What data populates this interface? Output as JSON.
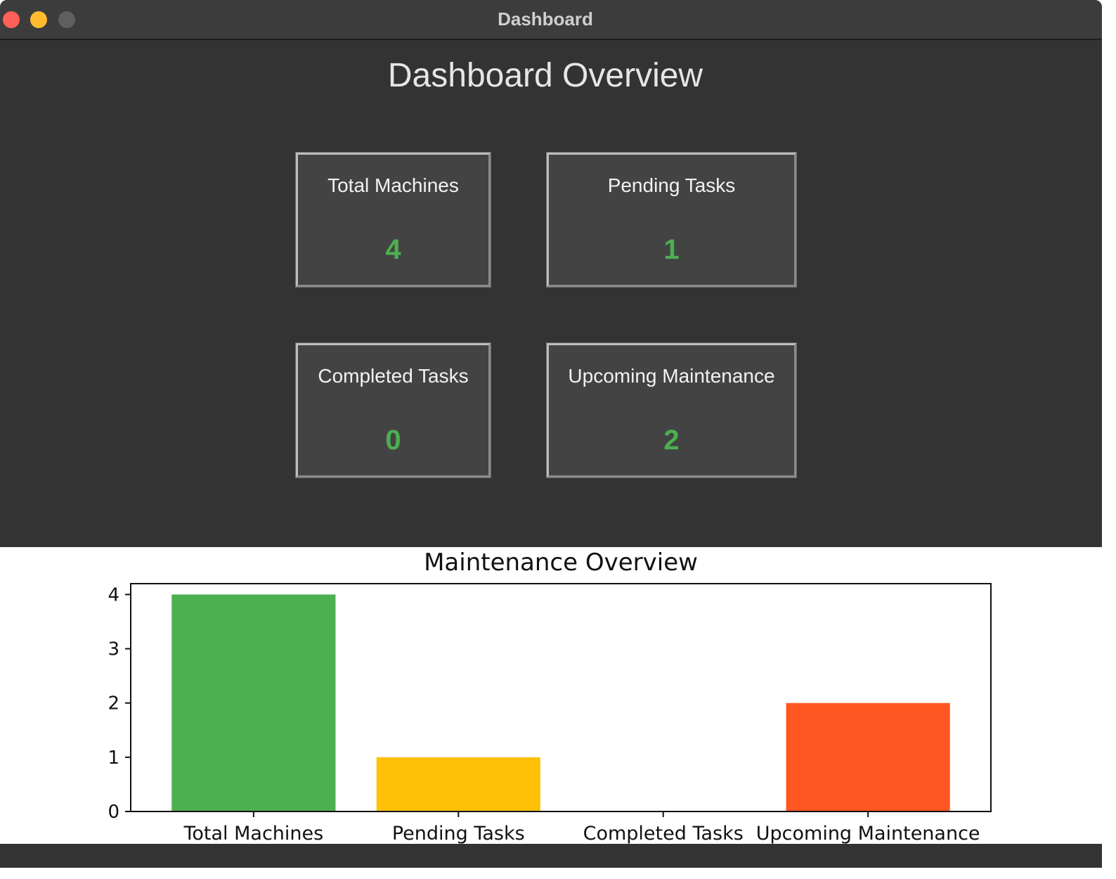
{
  "window": {
    "title": "Dashboard",
    "controls": [
      "close-button",
      "minimize-button",
      "zoom-button"
    ]
  },
  "dashboard": {
    "heading": "Dashboard Overview",
    "cards": [
      {
        "label": "Total Machines",
        "value": "4"
      },
      {
        "label": "Pending Tasks",
        "value": "1"
      },
      {
        "label": "Completed Tasks",
        "value": "0"
      },
      {
        "label": "Upcoming Maintenance",
        "value": "2"
      }
    ],
    "value_color": "#4caf50"
  },
  "chart_data": {
    "type": "bar",
    "title": "Maintenance Overview",
    "xlabel": "",
    "ylabel": "",
    "categories": [
      "Total Machines",
      "Pending Tasks",
      "Completed Tasks",
      "Upcoming Maintenance"
    ],
    "values": [
      4,
      1,
      0,
      2
    ],
    "colors": [
      "#4caf50",
      "#ffc107",
      "#2196f3",
      "#ff5722"
    ],
    "ylim": [
      0,
      4.2
    ],
    "yticks": [
      "0",
      "1",
      "2",
      "3",
      "4"
    ],
    "grid": false
  }
}
